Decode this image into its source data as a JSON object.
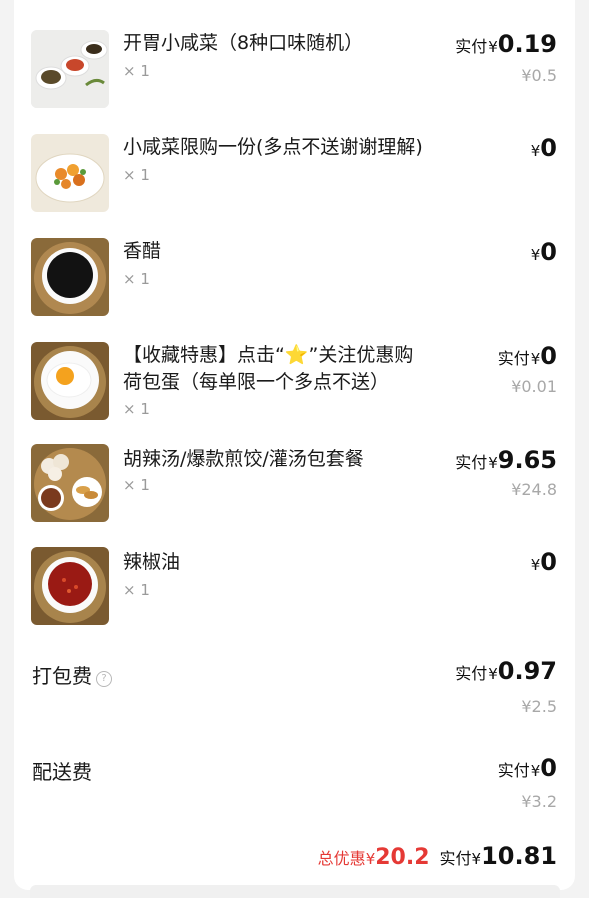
{
  "order": {
    "items": [
      {
        "name": "开胃小咸菜（8种口味随机）",
        "name_line2": "",
        "qty": "× 1",
        "price_label": "实付",
        "currency": "¥",
        "price": "0.19",
        "original": "¥0.5",
        "thumb": "pickles-dishes-image"
      },
      {
        "name": "小咸菜限购一份(多点不送谢谢理解)",
        "name_line2": "",
        "qty": "× 1",
        "price_label": "",
        "currency": "¥",
        "price": "0",
        "original": "",
        "thumb": "pickle-plate-image"
      },
      {
        "name": "香醋",
        "name_line2": "",
        "qty": "× 1",
        "price_label": "",
        "currency": "¥",
        "price": "0",
        "original": "",
        "thumb": "vinegar-bowl-image"
      },
      {
        "name": "【收藏特惠】点击“⭐”关注优惠购",
        "name_line2": "荷包蛋（每单限一个多点不送）",
        "qty": "× 1",
        "price_label": "实付",
        "currency": "¥",
        "price": "0",
        "original": "¥0.01",
        "thumb": "fried-egg-image"
      },
      {
        "name": "胡辣汤/爆款煎饺/灌汤包套餐",
        "name_line2": "",
        "qty": "× 1",
        "price_label": "实付",
        "currency": "¥",
        "price": "9.65",
        "original": "¥24.8",
        "thumb": "combo-set-image"
      },
      {
        "name": "辣椒油",
        "name_line2": "",
        "qty": "× 1",
        "price_label": "",
        "currency": "¥",
        "price": "0",
        "original": "",
        "thumb": "chili-oil-image"
      }
    ],
    "packing_fee": {
      "label": "打包费",
      "info_icon": "?",
      "price_label": "实付",
      "currency": "¥",
      "price": "0.97",
      "original": "¥2.5"
    },
    "delivery_fee": {
      "label": "配送费",
      "price_label": "实付",
      "currency": "¥",
      "price": "0",
      "original": "¥3.2"
    },
    "total": {
      "discount_label": "总优惠",
      "discount_currency": "¥",
      "discount": "20.2",
      "paid_label": "实付",
      "paid_currency": "¥",
      "paid": "10.81"
    }
  },
  "colors": {
    "accent_red": "#e53935",
    "muted": "#a8a8a8"
  }
}
